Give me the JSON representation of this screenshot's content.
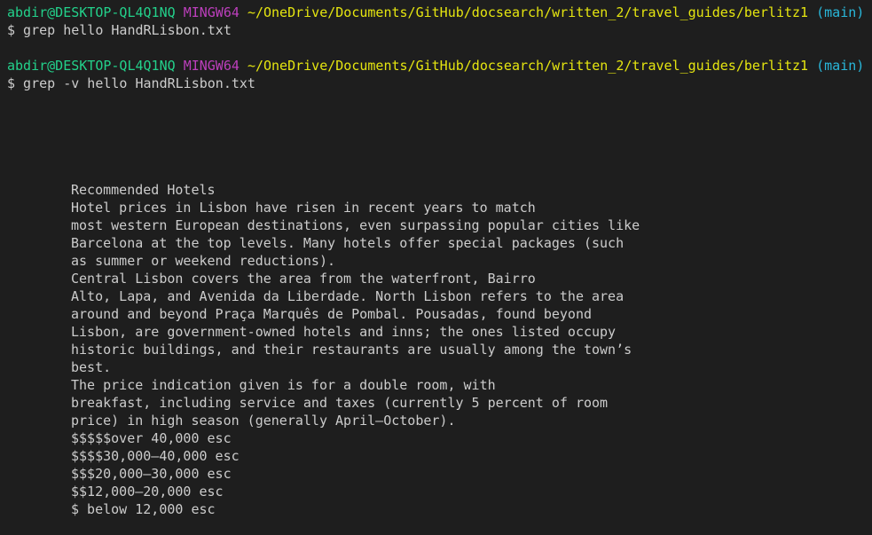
{
  "colors": {
    "background": "#1e1e1e",
    "text": "#cccccc",
    "user_host": "#23d18b",
    "shell": "#bc3fbc",
    "path": "#e5e510",
    "branch": "#29b8db"
  },
  "prompts": [
    {
      "user_host": "abdir@DESKTOP-QL4Q1NQ",
      "shell": "MINGW64",
      "path": "~/OneDrive/Documents/GitHub/docsearch/written_2/travel_guides/berlitz1",
      "branch": "(main)",
      "command": "$ grep hello HandRLisbon.txt"
    },
    {
      "user_host": "abdir@DESKTOP-QL4Q1NQ",
      "shell": "MINGW64",
      "path": "~/OneDrive/Documents/GitHub/docsearch/written_2/travel_guides/berlitz1",
      "branch": "(main)",
      "command": "$ grep -v hello HandRLisbon.txt"
    }
  ],
  "output_lines": [
    "Recommended Hotels",
    "Hotel prices in Lisbon have risen in recent years to match",
    "most western European destinations, even surpassing popular cities like",
    "Barcelona at the top levels. Many hotels offer special packages (such",
    "as summer or weekend reductions).",
    "Central Lisbon covers the area from the waterfront, Bairro",
    "Alto, Lapa, and Avenida da Liberdade. North Lisbon refers to the area",
    "around and beyond Praça Marquês de Pombal. Pousadas, found beyond",
    "Lisbon, are government-owned hotels and inns; the ones listed occupy",
    "historic buildings, and their restaurants are usually among the town’s",
    "best.",
    "The price indication given is for a double room, with",
    "breakfast, including service and taxes (currently 5 percent of room",
    "price) in high season (generally April–October).",
    "$$$$$over 40,000 esc",
    "$$$$30,000–40,000 esc",
    "$$$20,000–30,000 esc",
    "$$12,000–20,000 esc",
    "$ below 12,000 esc"
  ]
}
